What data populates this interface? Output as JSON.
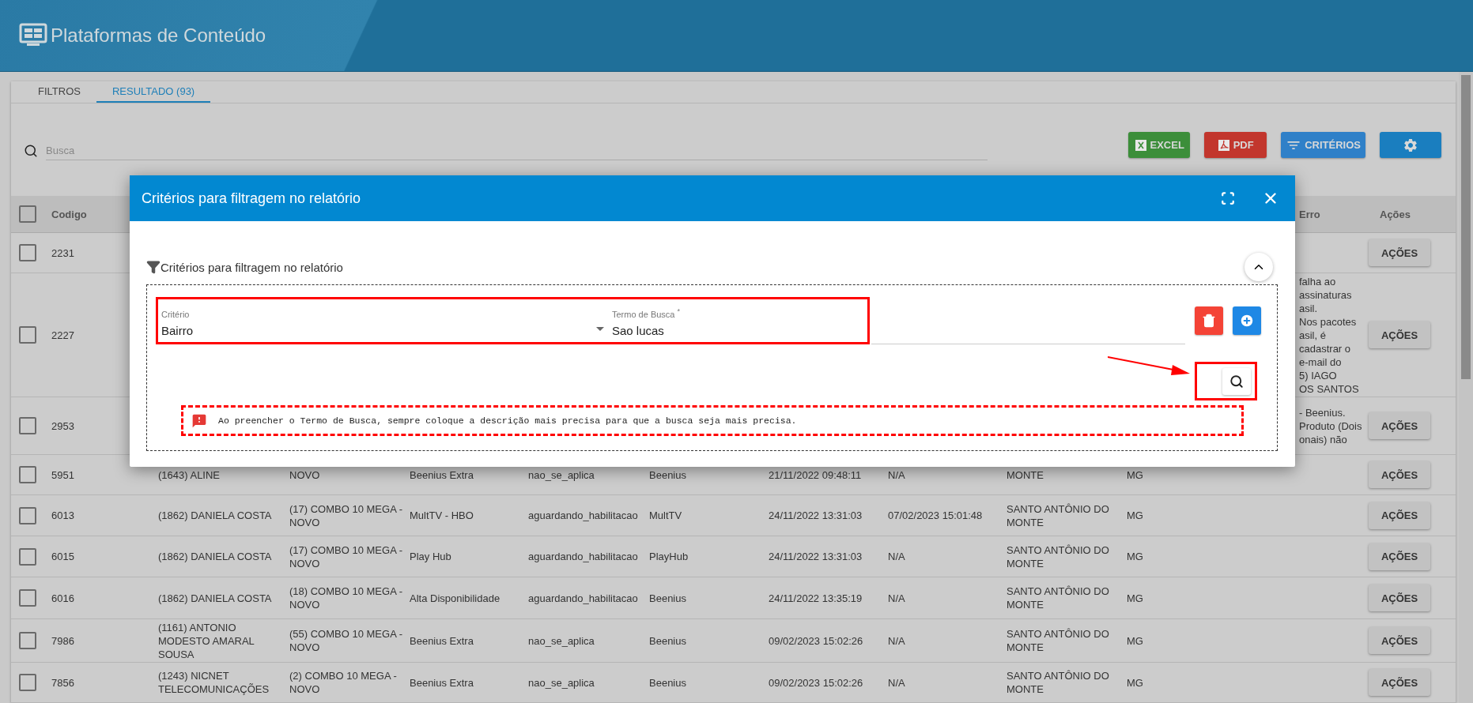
{
  "header": {
    "title": "Plataformas de Conteúdo"
  },
  "tabs": [
    {
      "label": "FILTROS",
      "selected": false
    },
    {
      "label": "RESULTADO (93)",
      "selected": true
    }
  ],
  "search": {
    "placeholder": "Busca"
  },
  "toolbar": [
    {
      "kind": "excel",
      "label": "EXCEL"
    },
    {
      "kind": "pdf",
      "label": "PDF"
    },
    {
      "kind": "criteria",
      "label": "CRITÉRIOS"
    },
    {
      "kind": "settings"
    }
  ],
  "table": {
    "select_all_checked": false,
    "columns": {
      "codigo": "Codigo",
      "erro": "Erro",
      "acoes": "Ações"
    },
    "rows": [
      {
        "checked": false,
        "codigo": "2231",
        "action": "AÇÕES"
      },
      {
        "checked": false,
        "codigo": "2227",
        "erro": "falha ao\nassinaturas\nasil.\nNos pacotes\nasil, é\ncadastrar o\ne-mail do\n5) IAGO\nOS SANTOS",
        "action": "AÇÕES"
      },
      {
        "checked": false,
        "codigo": "2953",
        "erro": "- Beenius.\nProduto (Dois\nonais) não",
        "action": "AÇÕES"
      },
      {
        "checked": false,
        "codigo": "5951",
        "cliente": "(1643) ALINE",
        "plano": "NOVO",
        "produto": "Beenius Extra",
        "status": "nao_se_aplica",
        "plataforma": "Beenius",
        "criado": "21/11/2022 09:48:11",
        "habilitado": "N/A",
        "cidade": "MONTE",
        "uf": "MG",
        "action": "AÇÕES"
      },
      {
        "checked": false,
        "codigo": "6013",
        "cliente": "(1862) DANIELA COSTA",
        "plano": "(17) COMBO 10 MEGA - NOVO",
        "produto": "MultTV - HBO",
        "status": "aguardando_habilitacao",
        "plataforma": "MultTV",
        "criado": "24/11/2022 13:31:03",
        "habilitado": "07/02/2023 15:01:48",
        "cidade": "SANTO ANTÔNIO DO MONTE",
        "uf": "MG",
        "action": "AÇÕES"
      },
      {
        "checked": false,
        "codigo": "6015",
        "cliente": "(1862) DANIELA COSTA",
        "plano": "(17) COMBO 10 MEGA - NOVO",
        "produto": "Play Hub",
        "status": "aguardando_habilitacao",
        "plataforma": "PlayHub",
        "criado": "24/11/2022 13:31:03",
        "habilitado": "N/A",
        "cidade": "SANTO ANTÔNIO DO MONTE",
        "uf": "MG",
        "action": "AÇÕES"
      },
      {
        "checked": false,
        "codigo": "6016",
        "cliente": "(1862) DANIELA COSTA",
        "plano": "(18) COMBO 10 MEGA - NOVO",
        "produto": "Alta Disponibilidade",
        "status": "aguardando_habilitacao",
        "plataforma": "Beenius",
        "criado": "24/11/2022 13:35:19",
        "habilitado": "N/A",
        "cidade": "SANTO ANTÔNIO DO MONTE",
        "uf": "MG",
        "action": "AÇÕES"
      },
      {
        "checked": false,
        "codigo": "7986",
        "cliente": "(1161) ANTONIO MODESTO AMARAL SOUSA",
        "plano": "(55) COMBO 10 MEGA - NOVO",
        "produto": "Beenius Extra",
        "status": "nao_se_aplica",
        "plataforma": "Beenius",
        "criado": "09/02/2023 15:02:26",
        "habilitado": "N/A",
        "cidade": "SANTO ANTÔNIO DO MONTE",
        "uf": "MG",
        "action": "AÇÕES"
      },
      {
        "checked": false,
        "codigo": "7856",
        "cliente": "(1243) NICNET TELECOMUNICAÇÕES",
        "plano": "(2) COMBO 10 MEGA - NOVO",
        "produto": "Beenius Extra",
        "status": "nao_se_aplica",
        "plataforma": "Beenius",
        "criado": "09/02/2023 15:02:26",
        "habilitado": "N/A",
        "cidade": "SANTO ANTÔNIO DO MONTE",
        "uf": "MG",
        "action": "AÇÕES"
      }
    ]
  },
  "modal": {
    "title": "Critérios para filtragem no relatório",
    "section_title": "Critérios para filtragem no relatório",
    "expanded": true,
    "criteria": [
      {
        "field_label": "Critério",
        "value": "Bairro",
        "term_label": "Termo de Busca",
        "required_mark": "*",
        "term_value": "Sao lucas"
      }
    ],
    "notice": "Ao preencher o Termo de Busca, sempre coloque a descrição mais precisa para que a busca seja mais precisa."
  }
}
